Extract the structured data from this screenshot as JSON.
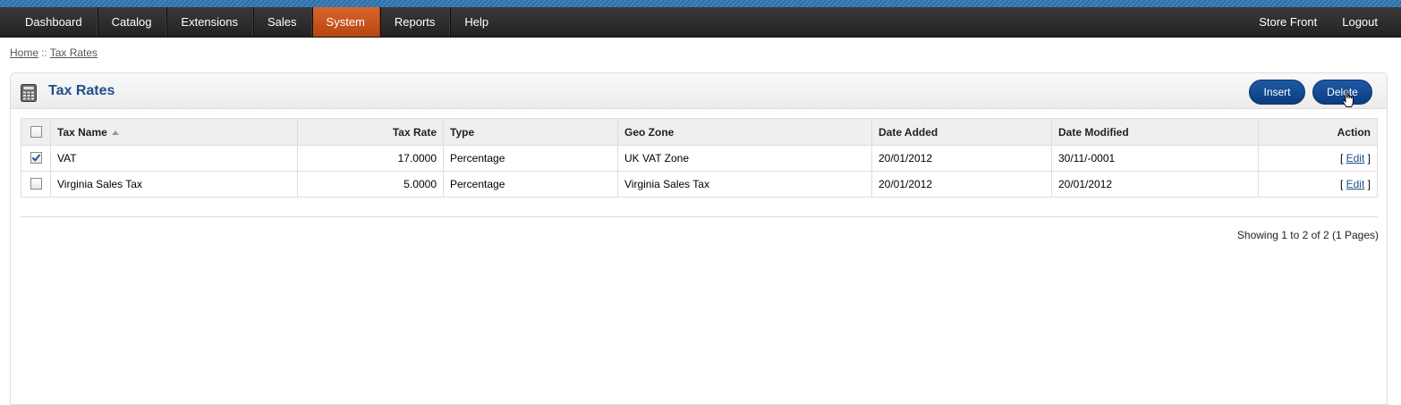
{
  "nav": {
    "left": [
      "Dashboard",
      "Catalog",
      "Extensions",
      "Sales",
      "System",
      "Reports",
      "Help"
    ],
    "active": "System",
    "right": [
      "Store Front",
      "Logout"
    ]
  },
  "breadcrumb": {
    "home": "Home",
    "separator": "::",
    "current": "Tax Rates"
  },
  "heading": {
    "title": "Tax Rates",
    "icon": "calculator-icon",
    "insert_label": "Insert",
    "delete_label": "Delete"
  },
  "table": {
    "columns": {
      "name": "Tax Name",
      "rate": "Tax Rate",
      "type": "Type",
      "geo_zone": "Geo Zone",
      "date_added": "Date Added",
      "date_modified": "Date Modified",
      "action": "Action"
    },
    "rows": [
      {
        "checked": true,
        "name": "VAT",
        "rate": "17.0000",
        "type": "Percentage",
        "geo_zone": "UK VAT Zone",
        "date_added": "20/01/2012",
        "date_modified": "30/11/-0001",
        "action_pre": "[",
        "action_edit": "Edit",
        "action_post": "]"
      },
      {
        "checked": false,
        "name": "Virginia Sales Tax",
        "rate": "5.0000",
        "type": "Percentage",
        "geo_zone": "Virginia Sales Tax",
        "date_added": "20/01/2012",
        "date_modified": "20/01/2012",
        "action_pre": "[",
        "action_edit": "Edit",
        "action_post": "]"
      }
    ]
  },
  "pagination": {
    "text": "Showing 1 to 2 of 2 (1 Pages)"
  },
  "colors": {
    "accent": "#1d4f8c",
    "active_menu": "#c6521c",
    "menubar": "#2a2a2a"
  }
}
